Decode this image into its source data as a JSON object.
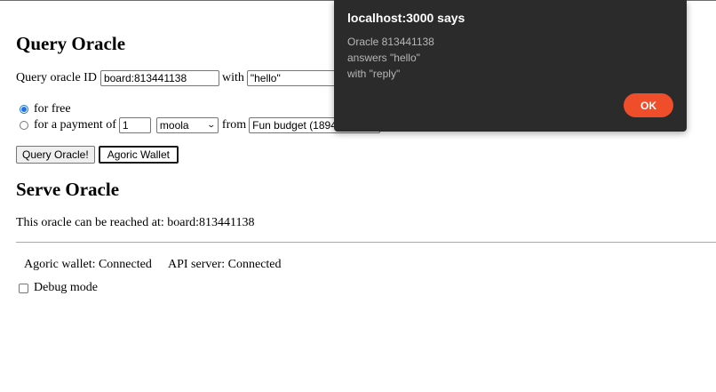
{
  "query": {
    "heading": "Query Oracle",
    "id_label": "Query oracle ID",
    "id_value": "board:813441138",
    "with_label": "with",
    "query_value": "\"hello\"",
    "free_label": "for free",
    "payment_label": "for a payment of",
    "amount_value": "1",
    "brand_selected": "moola",
    "from_label": "from",
    "budget_value": "Fun budget (1894",
    "query_button": "Query Oracle!",
    "wallet_button": "Agoric Wallet"
  },
  "serve": {
    "heading": "Serve Oracle",
    "reach_text": "This oracle can be reached at: board:813441138"
  },
  "status": {
    "wallet": "Agoric wallet: Connected",
    "api": "API server: Connected",
    "debug_label": "Debug mode"
  },
  "dialog": {
    "title": "localhost:3000 says",
    "line1": "Oracle 813441138",
    "line2": "answers \"hello\"",
    "line3": "with \"reply\"",
    "ok": "OK"
  },
  "colors": {
    "dialog_bg": "#2b2b2b",
    "ok_button": "#f04e2a",
    "radio_accent": "#1a73e8"
  }
}
